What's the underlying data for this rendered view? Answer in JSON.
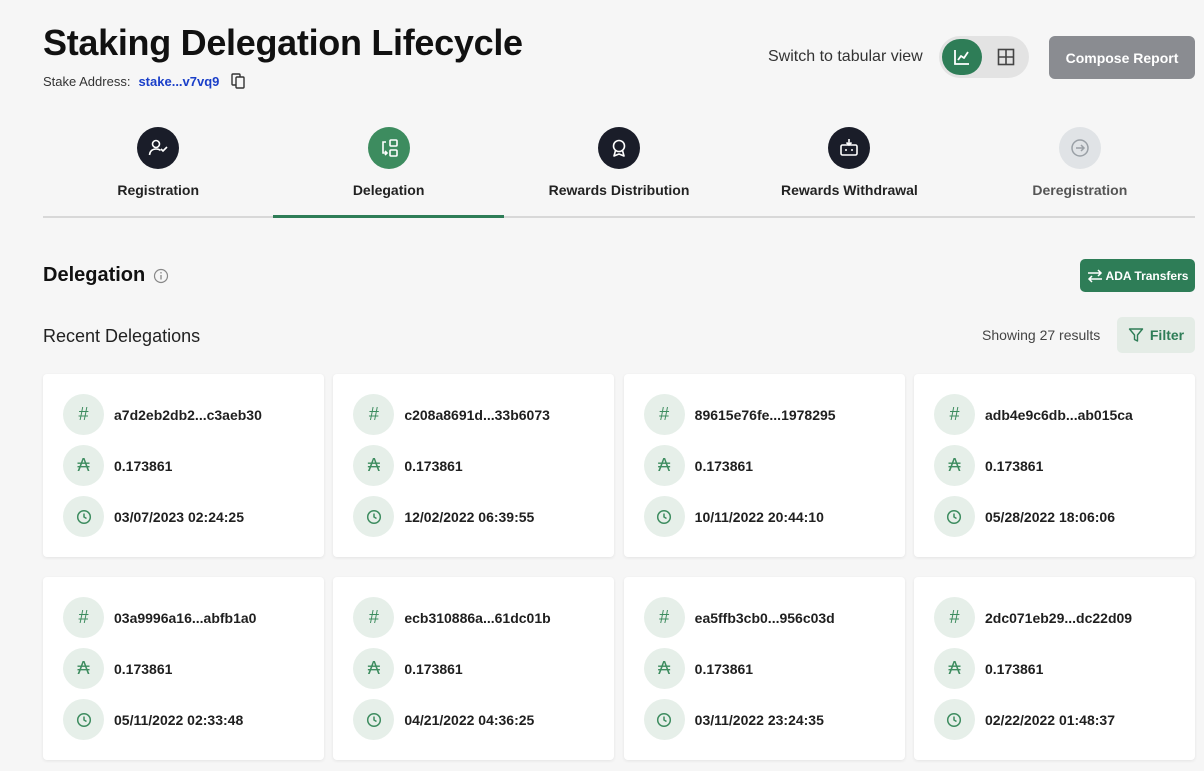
{
  "header": {
    "title": "Staking Delegation Lifecycle",
    "stake_label": "Stake Address:",
    "stake_address": "stake...v7vq9",
    "switch_label": "Switch to tabular view",
    "compose_label": "Compose Report"
  },
  "steps": [
    {
      "label": "Registration",
      "icon": "user-check-icon"
    },
    {
      "label": "Delegation",
      "icon": "delegation-icon",
      "active": true
    },
    {
      "label": "Rewards Distribution",
      "icon": "award-icon"
    },
    {
      "label": "Rewards Withdrawal",
      "icon": "withdrawal-icon"
    },
    {
      "label": "Deregistration",
      "icon": "exit-icon"
    }
  ],
  "section": {
    "title": "Delegation",
    "ada_transfers_label": "ADA Transfers",
    "recent_label": "Recent Delegations",
    "showing_text": "Showing 27 results",
    "filter_label": "Filter"
  },
  "cards": [
    {
      "hash": "a7d2eb2db2...c3aeb30",
      "amount": "0.173861",
      "time": "03/07/2023 02:24:25"
    },
    {
      "hash": "c208a8691d...33b6073",
      "amount": "0.173861",
      "time": "12/02/2022 06:39:55"
    },
    {
      "hash": "89615e76fe...1978295",
      "amount": "0.173861",
      "time": "10/11/2022 20:44:10"
    },
    {
      "hash": "adb4e9c6db...ab015ca",
      "amount": "0.173861",
      "time": "05/28/2022 18:06:06"
    },
    {
      "hash": "03a9996a16...abfb1a0",
      "amount": "0.173861",
      "time": "05/11/2022 02:33:48"
    },
    {
      "hash": "ecb310886a...61dc01b",
      "amount": "0.173861",
      "time": "04/21/2022 04:36:25"
    },
    {
      "hash": "ea5ffb3cb0...956c03d",
      "amount": "0.173861",
      "time": "03/11/2022 23:24:35"
    },
    {
      "hash": "2dc071eb29...dc22d09",
      "amount": "0.173861",
      "time": "02/22/2022 01:48:37"
    }
  ],
  "colors": {
    "accent": "#2e7d57",
    "link": "#1a3fc9",
    "dark_step": "#1a1d29",
    "compose_bg": "#8a8c91"
  }
}
